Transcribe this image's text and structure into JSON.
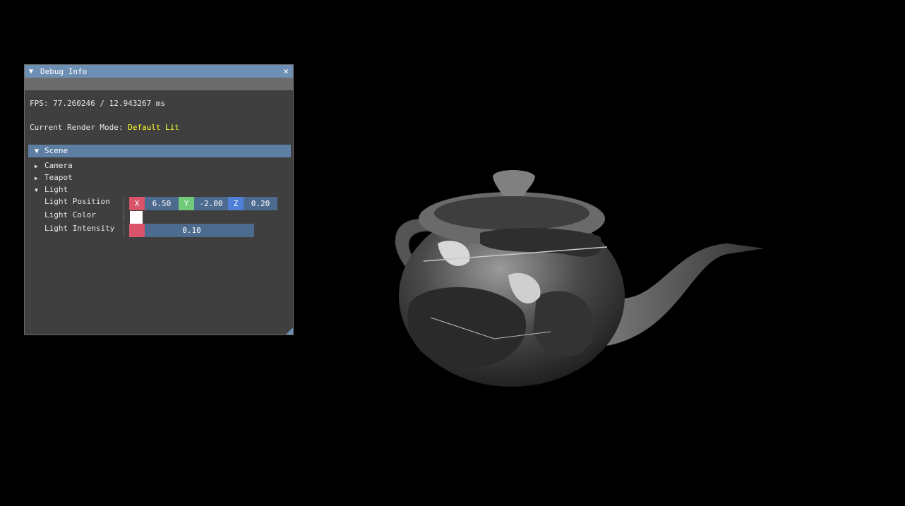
{
  "window": {
    "title": "Debug Info",
    "collapse_icon": "▼",
    "close_icon": "✕",
    "fps_text": "FPS: 77.260246 / 12.943267 ms",
    "render_mode_label": "Current Render Mode:",
    "render_mode_value": "Default Lit",
    "colors": {
      "title": "#6e8fb4",
      "header": "#5d7fa4",
      "mode_value": "#ffff2e"
    }
  },
  "scene": {
    "header": "Scene",
    "header_icon": "▼",
    "nodes": [
      {
        "label": "Camera",
        "icon": "▶"
      },
      {
        "label": "Teapot",
        "icon": "▶"
      },
      {
        "label": "Light",
        "icon": "▼"
      }
    ],
    "light": {
      "position_label": "Light Position",
      "x_label": "X",
      "x": "6.50",
      "y_label": "Y",
      "y": "-2.00",
      "z_label": "Z",
      "z": "0.20",
      "color_label": "Light Color",
      "color": "#ffffff",
      "intensity_label": "Light Intensity",
      "intensity": "0.10"
    }
  }
}
